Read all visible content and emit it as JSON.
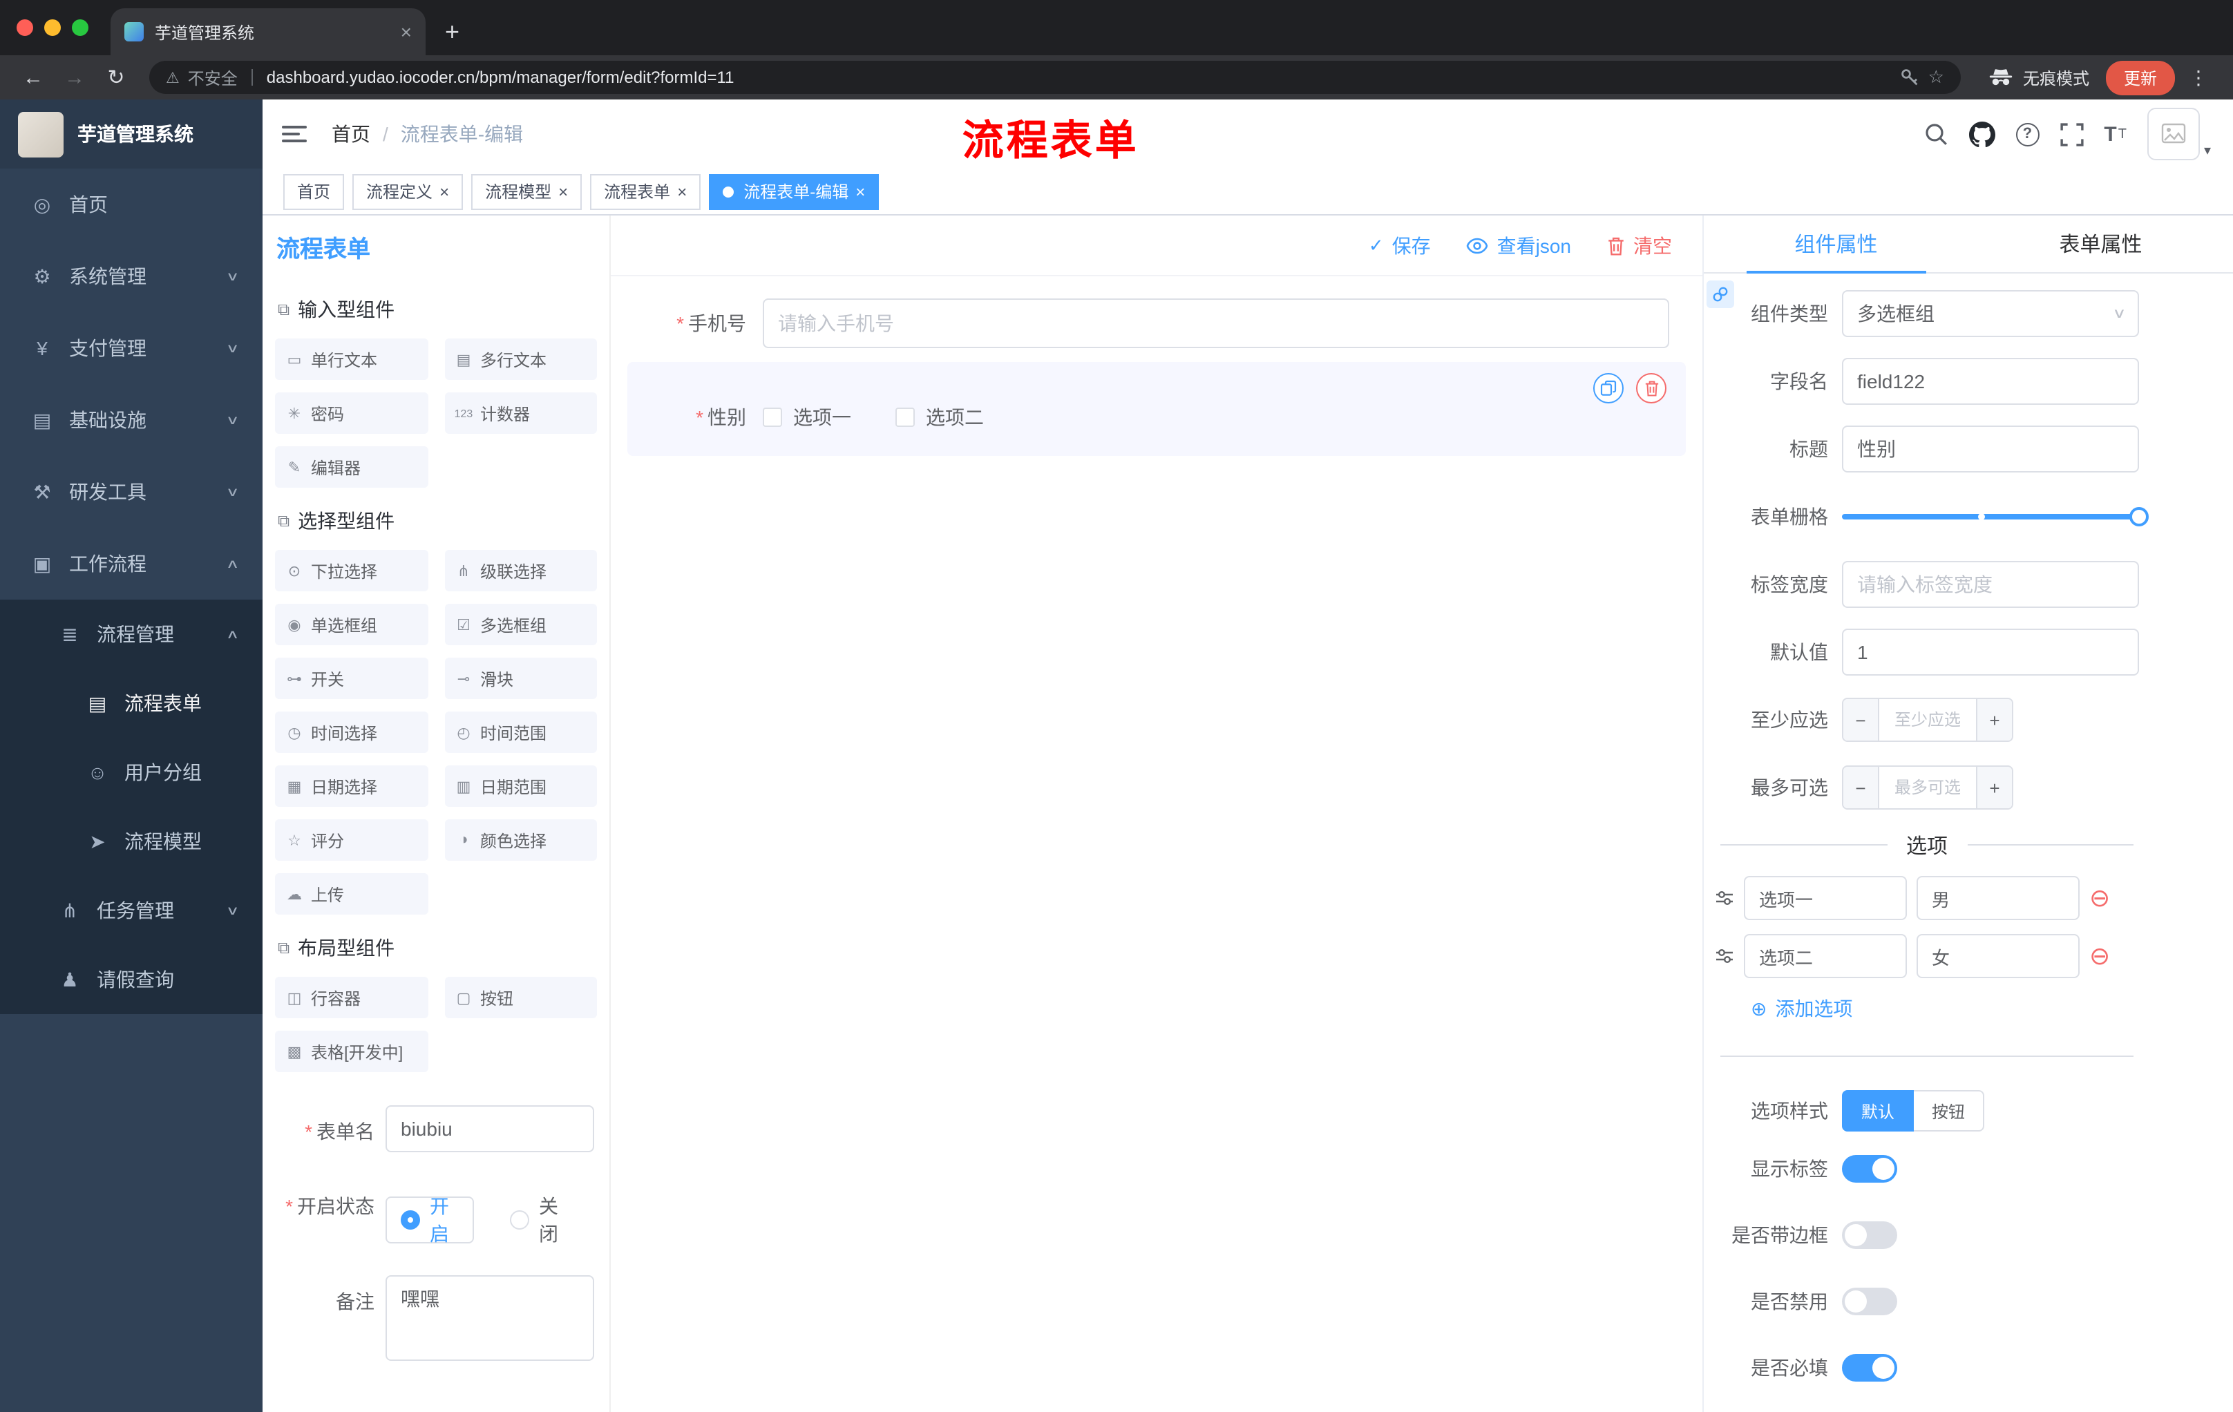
{
  "misc": {
    "required_marker": "*"
  },
  "icons": {
    "back": "←",
    "forward": "→",
    "reload": "↻",
    "warning": "⚠",
    "star": "☆",
    "dots": "⋮",
    "close": "×",
    "plus": "+",
    "minus": "−",
    "question": "?",
    "chevron_down": "∨",
    "chevron_up": "∧",
    "caret_down": "▾",
    "select_caret": "∨",
    "component_group": "⧉",
    "check": "✓",
    "add_circle": "⊕",
    "remove_circle": "⊖",
    "font_size_large": "T",
    "font_size_small": "T"
  },
  "browser": {
    "tab_title": "芋道管理系统",
    "security_label": "不安全",
    "url": "dashboard.yudao.iocoder.cn/bpm/manager/form/edit?formId=11",
    "incognito_label": "无痕模式",
    "update_button": "更新"
  },
  "sidebar": {
    "logo_title": "芋道管理系统",
    "menu": [
      {
        "label": "首页",
        "icon": "dashboard-icon",
        "glyph": "◎"
      },
      {
        "label": "系统管理",
        "icon": "gear-icon",
        "glyph": "⚙",
        "chevron": "down"
      },
      {
        "label": "支付管理",
        "icon": "payment-icon",
        "glyph": "¥",
        "chevron": "down"
      },
      {
        "label": "基础设施",
        "icon": "infrastructure-icon",
        "glyph": "▤",
        "chevron": "down"
      },
      {
        "label": "研发工具",
        "icon": "devtools-icon",
        "glyph": "⚒",
        "chevron": "down"
      },
      {
        "label": "工作流程",
        "icon": "workflow-icon",
        "glyph": "▣",
        "chevron": "up"
      },
      {
        "label": "流程管理",
        "icon": "process-management-icon",
        "glyph": "≣",
        "chevron": "up"
      },
      {
        "label": "流程表单",
        "icon": "process-form-icon",
        "glyph": "▤",
        "active": true
      },
      {
        "label": "用户分组",
        "icon": "user-group-icon",
        "glyph": "☺"
      },
      {
        "label": "流程模型",
        "icon": "process-model-icon",
        "glyph": "➤"
      },
      {
        "label": "任务管理",
        "icon": "task-management-icon",
        "glyph": "⋔",
        "chevron": "down"
      },
      {
        "label": "请假查询",
        "icon": "leave-query-icon",
        "glyph": "♟"
      }
    ]
  },
  "header": {
    "breadcrumb_home": "首页",
    "breadcrumb_sep": "/",
    "breadcrumb_current": "流程表单-编辑",
    "overlay_title": "流程表单"
  },
  "tags_view": [
    {
      "label": "首页",
      "closable": false,
      "active": false
    },
    {
      "label": "流程定义",
      "closable": true,
      "active": false
    },
    {
      "label": "流程模型",
      "closable": true,
      "active": false
    },
    {
      "label": "流程表单",
      "closable": true,
      "active": false
    },
    {
      "label": "流程表单-编辑",
      "closable": true,
      "active": true
    }
  ],
  "palette": {
    "panel_title": "流程表单",
    "groups": [
      {
        "title": "输入型组件",
        "items": [
          {
            "label": "单行文本",
            "icon": "single-line-text-icon",
            "glyph": "▭"
          },
          {
            "label": "多行文本",
            "icon": "multi-line-text-icon",
            "glyph": "▤"
          },
          {
            "label": "密码",
            "icon": "password-icon",
            "glyph": "✳"
          },
          {
            "label": "计数器",
            "icon": "counter-icon",
            "glyph": "123"
          },
          {
            "label": "编辑器",
            "icon": "editor-icon",
            "glyph": "✎"
          }
        ]
      },
      {
        "title": "选择型组件",
        "items": [
          {
            "label": "下拉选择",
            "icon": "select-icon",
            "glyph": "⊙"
          },
          {
            "label": "级联选择",
            "icon": "cascader-icon",
            "glyph": "⋔"
          },
          {
            "label": "单选框组",
            "icon": "radio-group-icon",
            "glyph": "◉"
          },
          {
            "label": "多选框组",
            "icon": "checkbox-group-icon",
            "glyph": "☑"
          },
          {
            "label": "开关",
            "icon": "switch-icon",
            "glyph": "⊶"
          },
          {
            "label": "滑块",
            "icon": "slider-icon",
            "glyph": "⊸"
          },
          {
            "label": "时间选择",
            "icon": "time-picker-icon",
            "glyph": "◷"
          },
          {
            "label": "时间范围",
            "icon": "time-range-icon",
            "glyph": "◴"
          },
          {
            "label": "日期选择",
            "icon": "date-picker-icon",
            "glyph": "▦"
          },
          {
            "label": "日期范围",
            "icon": "date-range-icon",
            "glyph": "▥"
          },
          {
            "label": "评分",
            "icon": "rate-icon",
            "glyph": "☆"
          },
          {
            "label": "颜色选择",
            "icon": "color-picker-icon",
            "glyph": "◑"
          },
          {
            "label": "上传",
            "icon": "upload-icon",
            "glyph": "☁"
          }
        ]
      },
      {
        "title": "布局型组件",
        "items": [
          {
            "label": "行容器",
            "icon": "row-container-icon",
            "glyph": "◫"
          },
          {
            "label": "按钮",
            "icon": "button-icon",
            "glyph": "▢"
          },
          {
            "label": "表格[开发中]",
            "icon": "table-icon",
            "glyph": "▩"
          }
        ]
      }
    ],
    "form_config": {
      "name_label": "表单名",
      "name_value": "biubiu",
      "status_label": "开启状态",
      "status_on": "开启",
      "status_off": "关闭",
      "status_selected": "开启",
      "remark_label": "备注",
      "remark_value": "嘿嘿"
    }
  },
  "canvas": {
    "actions": {
      "save": "保存",
      "view_json": "查看json",
      "clear": "清空"
    },
    "phone_field": {
      "label": "手机号",
      "required": true,
      "placeholder": "请输入手机号"
    },
    "gender_field": {
      "label": "性别",
      "required": true,
      "option1": "选项一",
      "option2": "选项二",
      "selected": true
    }
  },
  "properties": {
    "tab_component": "组件属性",
    "tab_form": "表单属性",
    "active_tab": "组件属性",
    "component_type_label": "组件类型",
    "component_type_value": "多选框组",
    "field_name_label": "字段名",
    "field_name_value": "field122",
    "title_label": "标题",
    "title_value": "性别",
    "grid_label": "表单栅格",
    "label_width_label": "标签宽度",
    "label_width_placeholder": "请输入标签宽度",
    "default_label": "默认值",
    "default_value": "1",
    "min_label": "至少应选",
    "min_placeholder": "至少应选",
    "max_label": "最多可选",
    "max_placeholder": "最多可选",
    "options_title": "选项",
    "options": [
      {
        "name": "选项一",
        "value": "男"
      },
      {
        "name": "选项二",
        "value": "女"
      }
    ],
    "add_option_label": "添加选项",
    "style_label": "选项样式",
    "style_default": "默认",
    "style_button": "按钮",
    "style_selected": "默认",
    "show_label_label": "显示标签",
    "show_label_on": true,
    "border_label": "是否带边框",
    "border_on": false,
    "disabled_label": "是否禁用",
    "disabled_on": false,
    "required_label": "是否必填",
    "required_on": true
  }
}
